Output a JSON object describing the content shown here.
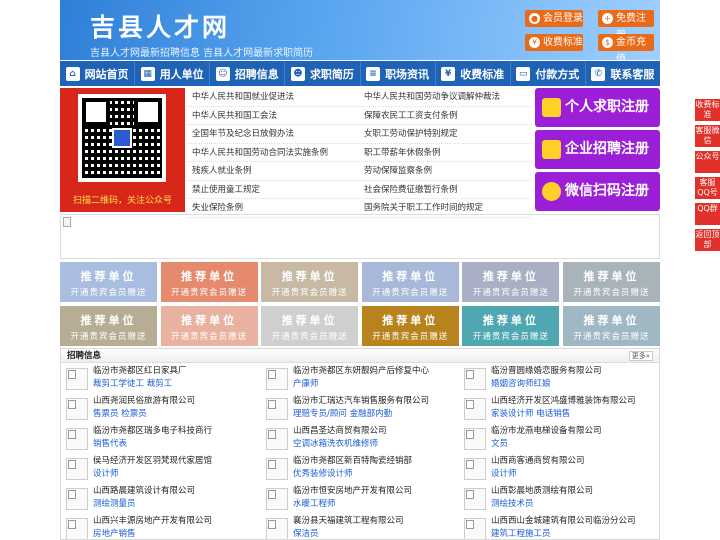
{
  "header": {
    "title": "吉县人才网",
    "subtitle": "吉县人才网最新招聘信息   吉县人才网最新求职简历",
    "buttons": [
      "会员登录",
      "免费注册",
      "收费标准",
      "金币充值"
    ]
  },
  "nav": [
    "网站首页",
    "用人单位",
    "招聘信息",
    "求职简历",
    "职场资讯",
    "收费标准",
    "付款方式",
    "联系客服"
  ],
  "qr_caption": "扫描二维码，关注公众号",
  "laws": [
    [
      "中华人民共和国就业促进法",
      "中华人民共和国劳动争议调解仲裁法"
    ],
    [
      "中华人民共和国工会法",
      "保障农民工工资支付条例"
    ],
    [
      "全国年节及纪念日放假办法",
      "女职工劳动保护特别规定"
    ],
    [
      "中华人民共和国劳动合同法实施条例",
      "职工带薪年休假条例"
    ],
    [
      "残疾人就业条例",
      "劳动保障监察条例"
    ],
    [
      "禁止使用童工规定",
      "社会保险费征缴暂行条例"
    ],
    [
      "失业保险条例",
      "国务院关于职工工作时间的规定"
    ]
  ],
  "register_buttons": [
    "个人求职注册",
    "企业招聘注册",
    "微信扫码注册"
  ],
  "right_float": [
    "收费标准",
    "客服微信",
    "公众号",
    "客服QQ号",
    "QQ群",
    "返回顶部"
  ],
  "tiles": {
    "line1": "推荐单位",
    "line2": "开通贵宾会员赠送",
    "colors": [
      "#a9bde0",
      "#e58a6c",
      "#c7b9a3",
      "#a8b8d8",
      "#a9b0c6",
      "#a8b4b9",
      "#b7ad94",
      "#e9b2a0",
      "#cfcfcf",
      "#b8821d",
      "#4fa7b2",
      "#9fb8c4"
    ]
  },
  "jobs": {
    "title": "招聘信息",
    "more": "更多»",
    "items": [
      {
        "company": "临汾市尧都区红日家具厂",
        "positions": "裁剪工学徒工 裁剪工"
      },
      {
        "company": "临汾市尧都区东妍靓妈产后修复中心",
        "positions": "产康师"
      },
      {
        "company": "临汾晋圆缘婚恋服务有限公司",
        "positions": "婚姻咨询师红娘"
      },
      {
        "company": "山西尧润民俗旅游有限公司",
        "positions": "售票员 检票员"
      },
      {
        "company": "临汾市汇瑞达汽车销售服务有限公司",
        "positions": "理赔专员/顾问 金融部内勤"
      },
      {
        "company": "山西经济开发区鸿盛博雅装饰有限公司",
        "positions": "家装设计师 电话销售"
      },
      {
        "company": "临汾市尧都区瑞多电子科技商行",
        "positions": "销售代表"
      },
      {
        "company": "山西昌圣达商贸有限公司",
        "positions": "空调冰箱洗衣机维修师"
      },
      {
        "company": "临汾市龙燕电梯设备有限公司",
        "positions": "文员"
      },
      {
        "company": "侯马经济开发区羽梵现代家居馆",
        "positions": "设计师"
      },
      {
        "company": "临汾市尧都区新百特陶瓷经销部",
        "positions": "优秀装修设计师"
      },
      {
        "company": "山西商客通商贸有限公司",
        "positions": "设计师"
      },
      {
        "company": "山西路晨建筑设计有限公司",
        "positions": "测绘测量员"
      },
      {
        "company": "临汾市恒安房地产开发有限公司",
        "positions": "水暖工程师"
      },
      {
        "company": "山西彰晨地质测绘有限公司",
        "positions": "测绘技术员"
      },
      {
        "company": "山西兴丰源房地产开发有限公司",
        "positions": "房地产销售"
      },
      {
        "company": "襄汾县天福建筑工程有限公司",
        "positions": "保洁员"
      },
      {
        "company": "山西西山金城建筑有限公司临汾分公司",
        "positions": "建筑工程施工员"
      }
    ]
  }
}
